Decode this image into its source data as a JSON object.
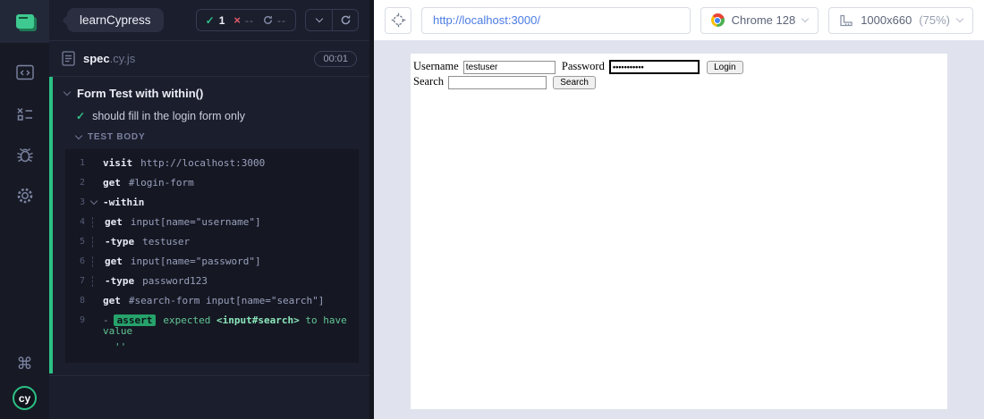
{
  "sidebar": {
    "icons": [
      "spec-active",
      "specs-code-window",
      "runs-checklist",
      "debug-bug",
      "settings-gear",
      "keyboard-shortcuts",
      "cypress-logo"
    ],
    "logo_text": "cy"
  },
  "reporter": {
    "project_name": "learnCypress",
    "stats": {
      "passed_count": "1",
      "failed_count": "--",
      "pending_count": "--"
    },
    "spec": {
      "name_bold": "spec",
      "name_ext": ".cy.js",
      "duration": "00:01"
    },
    "suite_title": "Form Test with within()",
    "test_title": "should fill in the login form only",
    "body_label": "TEST BODY",
    "commands": [
      {
        "num": "1",
        "method": "visit",
        "args": "http://localhost:3000"
      },
      {
        "num": "2",
        "method": "get",
        "args": "#login-form"
      },
      {
        "num": "3",
        "method": "-within",
        "args": ""
      },
      {
        "num": "4",
        "method": "get",
        "args": "input[name=\"username\"]"
      },
      {
        "num": "5",
        "method": "-type",
        "args": "testuser"
      },
      {
        "num": "6",
        "method": "get",
        "args": "input[name=\"password\"]"
      },
      {
        "num": "7",
        "method": "-type",
        "args": "password123"
      },
      {
        "num": "8",
        "method": "get",
        "args": "#search-form input[name=\"search\"]"
      },
      {
        "num": "9",
        "dash": "-",
        "badge": "assert",
        "pre": "expected",
        "subject": "<input#search>",
        "post": "to have value",
        "value": "''"
      }
    ]
  },
  "stage": {
    "url": "http://localhost:3000/",
    "browser_label": "Chrome 128",
    "viewport_label": "1000x660",
    "zoom_label": "(75%)"
  },
  "app_page": {
    "username_label": "Username",
    "username_value": "testuser",
    "password_label": "Password",
    "password_mask": "•••••••••••",
    "login_label": "Login",
    "search_label": "Search",
    "search_value": "",
    "search_button_label": "Search"
  },
  "colors": {
    "accent_green": "#2bc185",
    "fail_red": "#e05c6b",
    "url_blue": "#4b7ce2",
    "reporter_bg": "#1b1e2c",
    "command_log_bg": "#151823",
    "preview_bg": "#e0e3ed"
  }
}
